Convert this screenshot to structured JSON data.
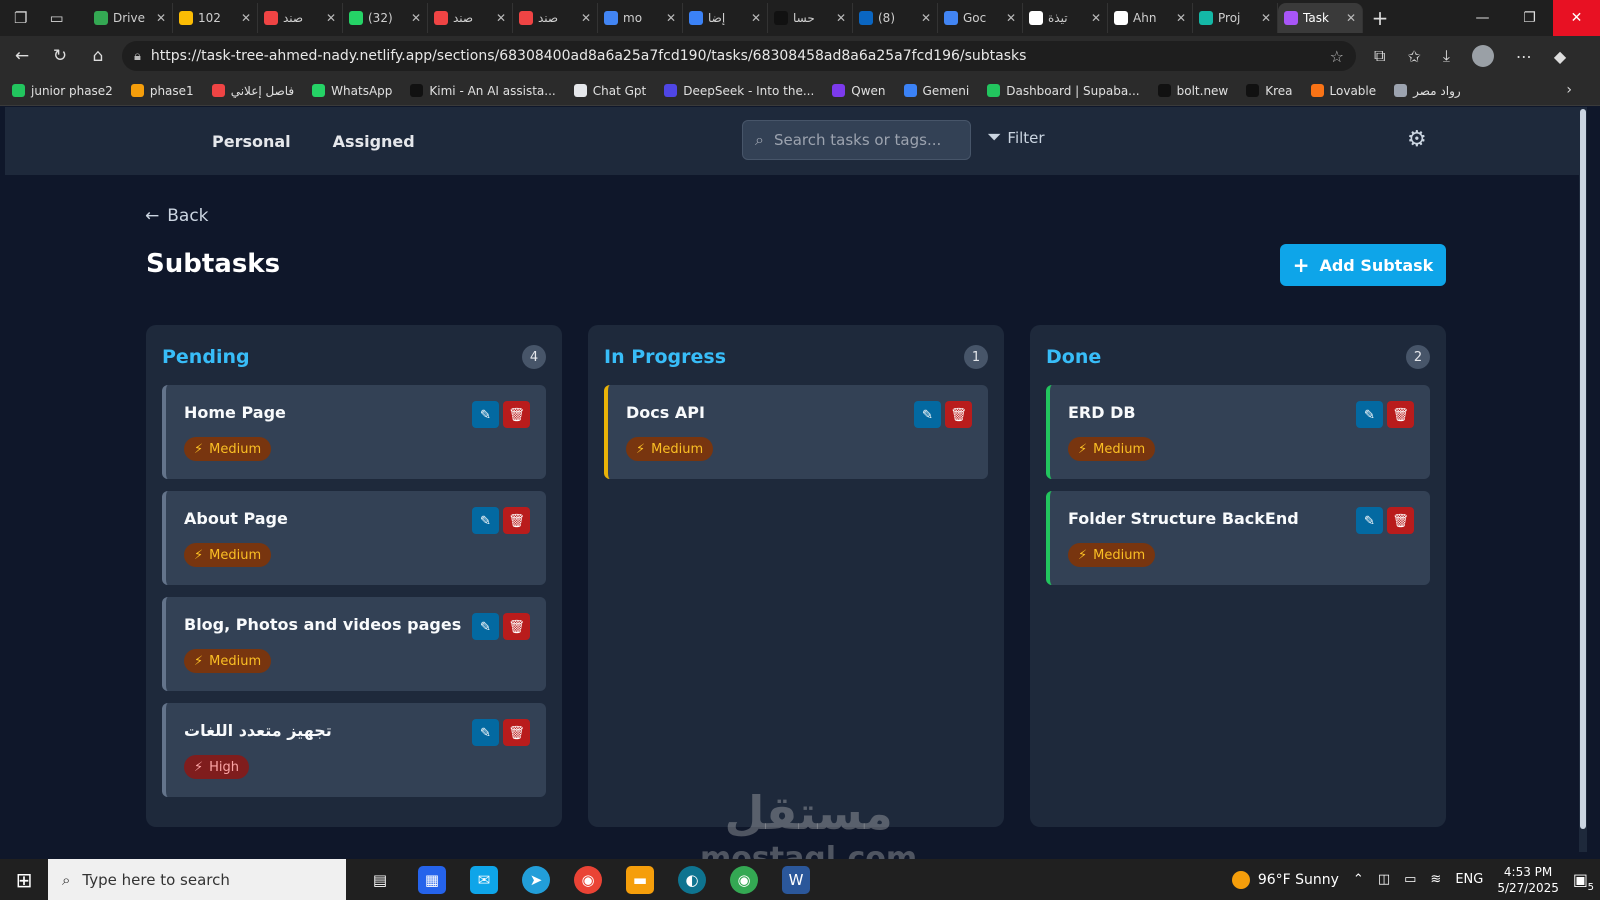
{
  "browser": {
    "tabs": [
      {
        "title": "Drive",
        "color": "#34a853"
      },
      {
        "title": "102",
        "color": "#fbbc04"
      },
      {
        "title": "صند",
        "color": "#ef4444"
      },
      {
        "title": "(32)",
        "color": "#25d366"
      },
      {
        "title": "صند",
        "color": "#ef4444"
      },
      {
        "title": "صند",
        "color": "#ef4444"
      },
      {
        "title": "mo",
        "color": "#4285f4"
      },
      {
        "title": "إضا",
        "color": "#3b82f6"
      },
      {
        "title": "حسا",
        "color": "#111111"
      },
      {
        "title": "(8)",
        "color": "#0a66c2"
      },
      {
        "title": "Goc",
        "color": "#4285f4"
      },
      {
        "title": "تيذة",
        "color": "#ffffff"
      },
      {
        "title": "Ahn",
        "color": "#ffffff"
      },
      {
        "title": "Proj",
        "color": "#14b8a6"
      },
      {
        "title": "Task",
        "color": "#a855f7",
        "active": true
      }
    ],
    "url": "https://task-tree-ahmed-nady.netlify.app/sections/68308400ad8a6a25a7fcd190/tasks/68308458ad8a6a25a7fcd196/subtasks",
    "bookmarks": [
      {
        "label": "junior phase2",
        "color": "#22c55e"
      },
      {
        "label": "phase1",
        "color": "#f59e0b"
      },
      {
        "label": "فاصل إعلاني",
        "color": "#ef4444"
      },
      {
        "label": "WhatsApp",
        "color": "#25d366"
      },
      {
        "label": "Kimi - An AI assista...",
        "color": "#111111"
      },
      {
        "label": "Chat Gpt",
        "color": "#e5e7eb"
      },
      {
        "label": "DeepSeek - Into the...",
        "color": "#4f46e5"
      },
      {
        "label": "Qwen",
        "color": "#7c3aed"
      },
      {
        "label": "Gemeni",
        "color": "#3b82f6"
      },
      {
        "label": "Dashboard | Supaba...",
        "color": "#22c55e"
      },
      {
        "label": "bolt.new",
        "color": "#111111"
      },
      {
        "label": "Krea",
        "color": "#111111"
      },
      {
        "label": "Lovable",
        "color": "#f97316"
      },
      {
        "label": "رواد مصر",
        "color": "#9ca3af"
      }
    ]
  },
  "header": {
    "nav": [
      "Personal",
      "Assigned"
    ],
    "search_placeholder": "Search tasks or tags...",
    "filter_label": "Filter"
  },
  "page": {
    "back_label": "Back",
    "title": "Subtasks",
    "add_button": "Add Subtask"
  },
  "columns": [
    {
      "title": "Pending",
      "count": "4",
      "status": "pending",
      "cards": [
        {
          "title": "Home Page",
          "priority": "Medium",
          "level": "medium"
        },
        {
          "title": "About Page",
          "priority": "Medium",
          "level": "medium"
        },
        {
          "title": "Blog, Photos and videos pages",
          "priority": "Medium",
          "level": "medium"
        },
        {
          "title": "تجهيز متعدد اللغات",
          "priority": "High",
          "level": "high"
        }
      ]
    },
    {
      "title": "In Progress",
      "count": "1",
      "status": "inprogress",
      "cards": [
        {
          "title": "Docs API",
          "priority": "Medium",
          "level": "medium"
        }
      ]
    },
    {
      "title": "Done",
      "count": "2",
      "status": "done",
      "cards": [
        {
          "title": "ERD DB",
          "priority": "Medium",
          "level": "medium"
        },
        {
          "title": "Folder Structure BackEnd",
          "priority": "Medium",
          "level": "medium"
        }
      ]
    }
  ],
  "watermark": {
    "ar": "مستقل",
    "en": "mostaql.com"
  },
  "taskbar": {
    "search_placeholder": "Type here to search",
    "weather": "96°F  Sunny",
    "lang": "ENG",
    "time": "4:53 PM",
    "date": "5/27/2025",
    "notifications": "5"
  },
  "colors": {
    "accent": "#0ea5e9",
    "column_title": "#38bdf8",
    "inprogress_border": "#eab308",
    "done_border": "#22c55e"
  }
}
